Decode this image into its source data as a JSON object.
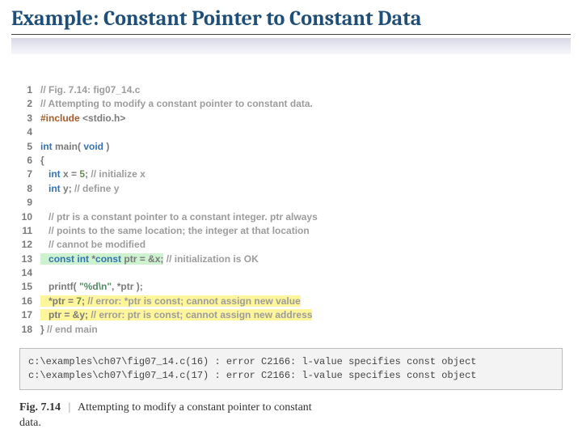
{
  "title": "Example: Constant Pointer to Constant Data",
  "code": {
    "lines": [
      {
        "n": "1",
        "segs": [
          {
            "t": "// Fig. 7.14: fig07_14.c",
            "c": "cm"
          }
        ]
      },
      {
        "n": "2",
        "segs": [
          {
            "t": "// Attempting to modify a constant pointer to constant data.",
            "c": "cm"
          }
        ]
      },
      {
        "n": "3",
        "segs": [
          {
            "t": "#include ",
            "c": "pp"
          },
          {
            "t": "<stdio.h>",
            "c": "id"
          }
        ]
      },
      {
        "n": "4",
        "segs": []
      },
      {
        "n": "5",
        "segs": [
          {
            "t": "int ",
            "c": "kw"
          },
          {
            "t": "main( ",
            "c": "id"
          },
          {
            "t": "void",
            "c": "kw"
          },
          {
            "t": " )",
            "c": "id"
          }
        ]
      },
      {
        "n": "6",
        "segs": [
          {
            "t": "{",
            "c": "id"
          }
        ]
      },
      {
        "n": "7",
        "segs": [
          {
            "t": "   ",
            "c": "id"
          },
          {
            "t": "int ",
            "c": "kw"
          },
          {
            "t": "x = ",
            "c": "id"
          },
          {
            "t": "5",
            "c": "nm"
          },
          {
            "t": "; ",
            "c": "id"
          },
          {
            "t": "// initialize x",
            "c": "cm"
          }
        ]
      },
      {
        "n": "8",
        "segs": [
          {
            "t": "   ",
            "c": "id"
          },
          {
            "t": "int ",
            "c": "kw"
          },
          {
            "t": "y; ",
            "c": "id"
          },
          {
            "t": "// define y",
            "c": "cm"
          }
        ]
      },
      {
        "n": "9",
        "segs": []
      },
      {
        "n": "10",
        "segs": [
          {
            "t": "   ",
            "c": "id"
          },
          {
            "t": "// ptr is a constant pointer to a constant integer. ptr always",
            "c": "cm"
          }
        ]
      },
      {
        "n": "11",
        "segs": [
          {
            "t": "   ",
            "c": "id"
          },
          {
            "t": "// points to the same location; the integer at that location",
            "c": "cm"
          }
        ]
      },
      {
        "n": "12",
        "segs": [
          {
            "t": "   ",
            "c": "id"
          },
          {
            "t": "// cannot be modified",
            "c": "cm"
          }
        ]
      },
      {
        "n": "13",
        "hl": "green",
        "segs": [
          {
            "t": "   ",
            "c": "id"
          },
          {
            "t": "const int ",
            "c": "kw"
          },
          {
            "t": "*",
            "c": "id"
          },
          {
            "t": "const ",
            "c": "kw"
          },
          {
            "t": "ptr = &x;",
            "c": "id"
          }
        ],
        "tail": [
          {
            "t": " ",
            "c": "id"
          },
          {
            "t": "// initialization is OK",
            "c": "cm"
          }
        ]
      },
      {
        "n": "14",
        "segs": []
      },
      {
        "n": "15",
        "segs": [
          {
            "t": "   printf( ",
            "c": "id"
          },
          {
            "t": "\"%d\\n\"",
            "c": "st"
          },
          {
            "t": ", *ptr );",
            "c": "id"
          }
        ]
      },
      {
        "n": "16",
        "hl": "yellow",
        "segs": [
          {
            "t": "   *ptr = ",
            "c": "id"
          },
          {
            "t": "7",
            "c": "nm"
          },
          {
            "t": "; ",
            "c": "id"
          },
          {
            "t": "// error: *ptr is const; cannot assign new value",
            "c": "cm"
          }
        ]
      },
      {
        "n": "17",
        "hl": "yellow",
        "segs": [
          {
            "t": "   ptr = &y; ",
            "c": "id"
          },
          {
            "t": "// error: ptr is const; cannot assign new address",
            "c": "cm"
          }
        ]
      },
      {
        "n": "18",
        "segs": [
          {
            "t": "} ",
            "c": "id"
          },
          {
            "t": "// end main",
            "c": "cm"
          }
        ]
      }
    ]
  },
  "output": {
    "line1": "c:\\examples\\ch07\\fig07_14.c(16) : error C2166: l-value specifies const object",
    "line2": "c:\\examples\\ch07\\fig07_14.c(17) : error C2166: l-value specifies const object"
  },
  "caption": {
    "fig": "Fig. 7.14",
    "bar": "|",
    "text1": "Attempting to modify a constant pointer to constant",
    "text2": "data."
  }
}
